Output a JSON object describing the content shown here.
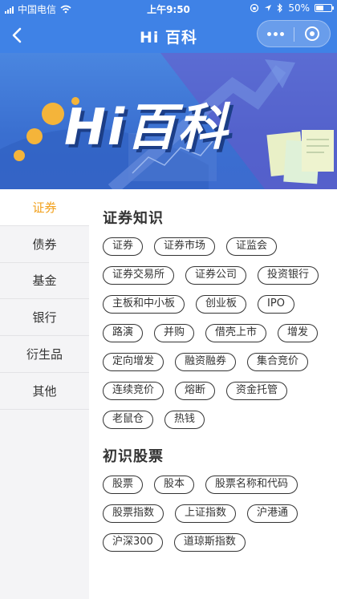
{
  "status_bar": {
    "carrier": "中国电信",
    "time": "上午9:50",
    "battery": "50%"
  },
  "nav": {
    "title": "Hi 百科"
  },
  "banner": {
    "title": "Hi百科"
  },
  "sidebar": {
    "items": [
      {
        "label": "证券",
        "active": true
      },
      {
        "label": "债券",
        "active": false
      },
      {
        "label": "基金",
        "active": false
      },
      {
        "label": "银行",
        "active": false
      },
      {
        "label": "衍生品",
        "active": false
      },
      {
        "label": "其他",
        "active": false
      }
    ]
  },
  "sections": [
    {
      "title": "证券知识",
      "tags": [
        "证券",
        "证券市场",
        "证监会",
        "证券交易所",
        "证券公司",
        "投资银行",
        "主板和中小板",
        "创业板",
        "IPO",
        "路演",
        "并购",
        "借壳上市",
        "增发",
        "定向增发",
        "融资融券",
        "集合竞价",
        "连续竞价",
        "熔断",
        "资金托管",
        "老鼠仓",
        "热钱"
      ]
    },
    {
      "title": "初识股票",
      "tags": [
        "股票",
        "股本",
        "股票名称和代码",
        "股票指数",
        "上证指数",
        "沪港通",
        "沪深300",
        "道琼斯指数"
      ]
    }
  ],
  "colors": {
    "nav_blue": "#3f82e6",
    "active_orange": "#f2a01b"
  }
}
